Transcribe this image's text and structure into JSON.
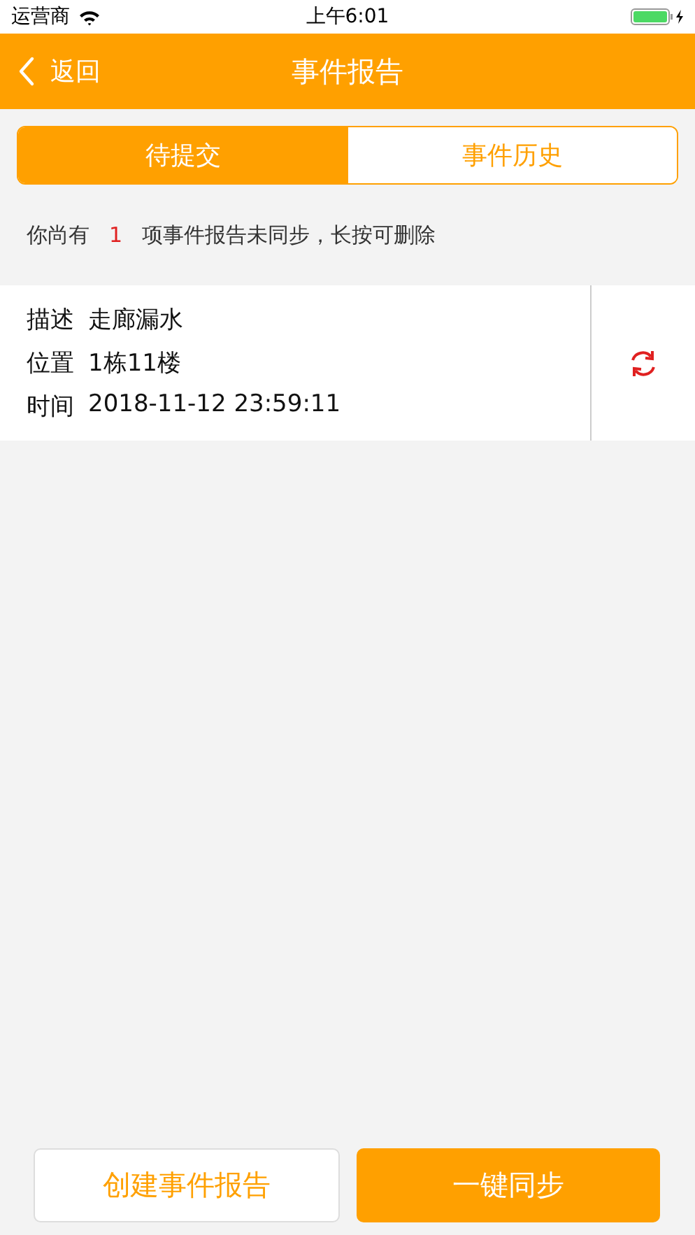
{
  "status_bar": {
    "carrier": "运营商",
    "time": "上午6:01"
  },
  "nav": {
    "back": "返回",
    "title": "事件报告"
  },
  "tabs": [
    {
      "label": "待提交",
      "selected": true
    },
    {
      "label": "事件历史",
      "selected": false
    }
  ],
  "notice": {
    "prefix": "你尚有",
    "count": "1",
    "suffix": "项事件报告未同步，长按可删除"
  },
  "reports": [
    {
      "fields": [
        {
          "label": "描述",
          "value": "走廊漏水"
        },
        {
          "label": "位置",
          "value": "1栋11楼"
        },
        {
          "label": "时间",
          "value": "2018-11-12 23:59:11"
        }
      ]
    }
  ],
  "buttons": [
    {
      "label": "创建事件报告",
      "kind": "outline"
    },
    {
      "label": "一键同步",
      "kind": "filled"
    }
  ]
}
